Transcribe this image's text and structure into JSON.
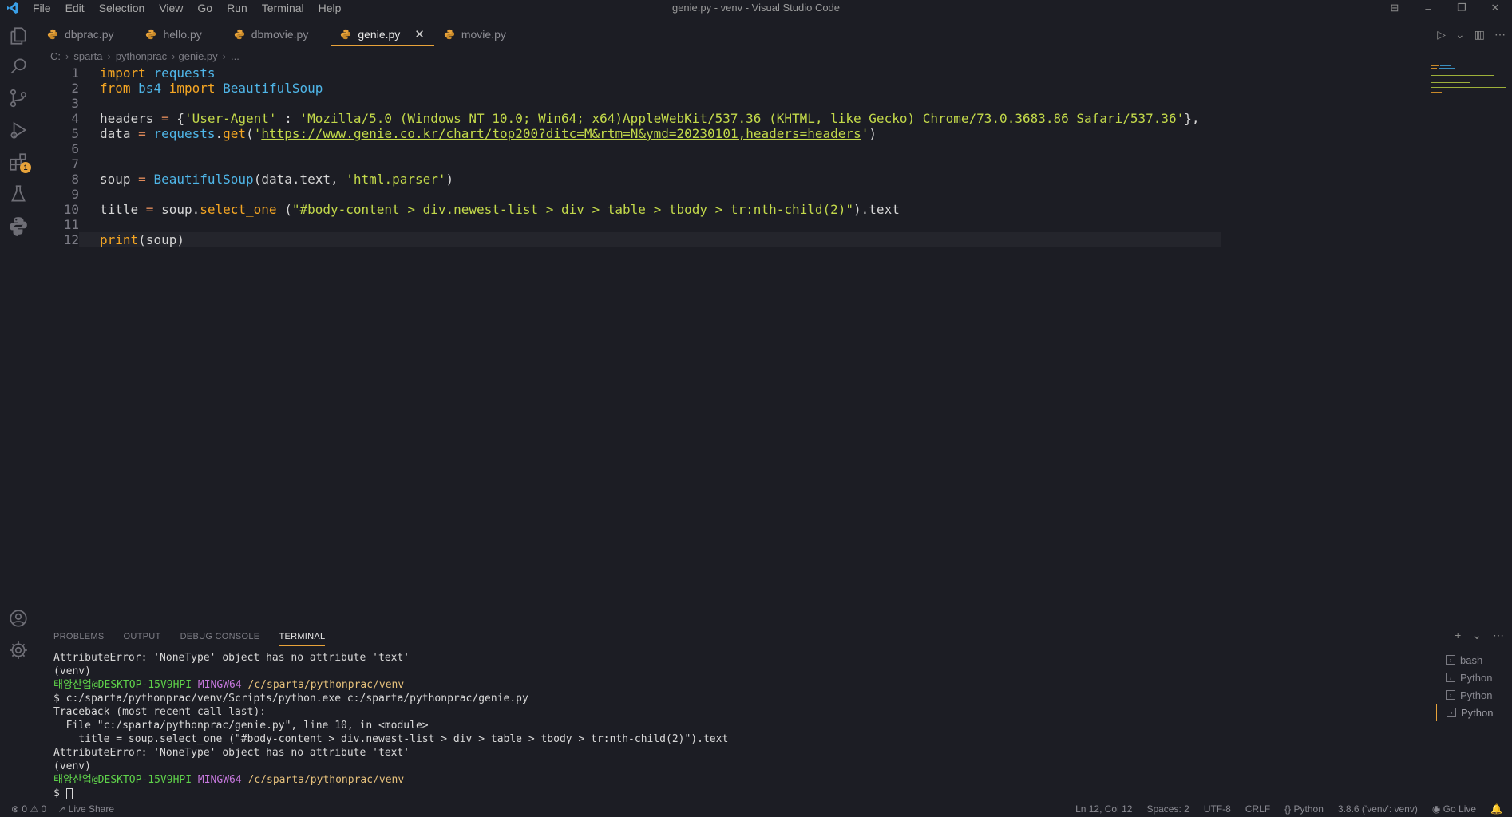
{
  "window": {
    "title": "genie.py - venv - Visual Studio Code",
    "controls": [
      "⊟",
      "–",
      "❐",
      "✕"
    ]
  },
  "menu": [
    "File",
    "Edit",
    "Selection",
    "View",
    "Go",
    "Run",
    "Terminal",
    "Help"
  ],
  "tabs": [
    {
      "label": "dbprac.py",
      "active": false
    },
    {
      "label": "hello.py",
      "active": false
    },
    {
      "label": "dbmovie.py",
      "active": false
    },
    {
      "label": "genie.py",
      "active": true
    },
    {
      "label": "movie.py",
      "active": false
    }
  ],
  "breadcrumb": [
    "C:",
    "sparta",
    "pythonprac",
    "genie.py",
    "..."
  ],
  "editor": {
    "lines": [
      {
        "num": "1",
        "tokens": [
          [
            "kw",
            "import"
          ],
          [
            "plain",
            " "
          ],
          [
            "mod",
            "requests"
          ]
        ]
      },
      {
        "num": "2",
        "tokens": [
          [
            "kw",
            "from"
          ],
          [
            "plain",
            " "
          ],
          [
            "mod",
            "bs4"
          ],
          [
            "plain",
            " "
          ],
          [
            "kw",
            "import"
          ],
          [
            "plain",
            " "
          ],
          [
            "cls",
            "BeautifulSoup"
          ]
        ]
      },
      {
        "num": "3",
        "tokens": []
      },
      {
        "num": "4",
        "tokens": [
          [
            "plain",
            "headers "
          ],
          [
            "op",
            "="
          ],
          [
            "plain",
            " {"
          ],
          [
            "str",
            "'User-Agent'"
          ],
          [
            "plain",
            " : "
          ],
          [
            "str",
            "'Mozilla/5.0 (Windows NT 10.0; Win64; x64)AppleWebKit/537.36 (KHTML, like Gecko) Chrome/73.0.3683.86 Safari/537.36'"
          ],
          [
            "plain",
            "},"
          ]
        ]
      },
      {
        "num": "5",
        "tokens": [
          [
            "plain",
            "data "
          ],
          [
            "op",
            "="
          ],
          [
            "plain",
            " "
          ],
          [
            "mod",
            "requests"
          ],
          [
            "plain",
            "."
          ],
          [
            "fn",
            "get"
          ],
          [
            "plain",
            "("
          ],
          [
            "str",
            "'"
          ],
          [
            "url",
            "https://www.genie.co.kr/chart/top200?ditc=M&rtm=N&ymd=20230101,headers=headers"
          ],
          [
            "str",
            "'"
          ],
          [
            "plain",
            ")"
          ]
        ]
      },
      {
        "num": "6",
        "tokens": []
      },
      {
        "num": "7",
        "tokens": []
      },
      {
        "num": "8",
        "tokens": [
          [
            "plain",
            "soup "
          ],
          [
            "op",
            "="
          ],
          [
            "plain",
            " "
          ],
          [
            "cls",
            "BeautifulSoup"
          ],
          [
            "plain",
            "(data.text, "
          ],
          [
            "str",
            "'html.parser'"
          ],
          [
            "plain",
            ")"
          ]
        ]
      },
      {
        "num": "9",
        "tokens": []
      },
      {
        "num": "10",
        "tokens": [
          [
            "plain",
            "title "
          ],
          [
            "op",
            "="
          ],
          [
            "plain",
            " soup."
          ],
          [
            "fn",
            "select_one"
          ],
          [
            "plain",
            " ("
          ],
          [
            "str",
            "\"#body-content > div.newest-list > div > table > tbody > tr:nth-child(2)\""
          ],
          [
            "plain",
            ").text"
          ]
        ]
      },
      {
        "num": "11",
        "tokens": []
      },
      {
        "num": "12",
        "tokens": [
          [
            "fn",
            "print"
          ],
          [
            "plain",
            "(soup)"
          ]
        ]
      }
    ]
  },
  "panel": {
    "tabs": [
      "PROBLEMS",
      "OUTPUT",
      "DEBUG CONSOLE",
      "TERMINAL"
    ],
    "active_tab": "TERMINAL",
    "actions": [
      "+",
      "⌄",
      "⋯"
    ],
    "terminal_lines": [
      [
        [
          "",
          "AttributeError: 'NoneType' object has no attribute 'text'"
        ]
      ],
      [
        [
          "",
          "(venv)"
        ]
      ],
      [
        [
          "t-green",
          "태양산업@DESKTOP-15V9HPI "
        ],
        [
          "t-purple",
          "MINGW64 "
        ],
        [
          "t-yellow",
          "/c/sparta/pythonprac/venv"
        ]
      ],
      [
        [
          "",
          "$ c:/sparta/pythonprac/venv/Scripts/python.exe c:/sparta/pythonprac/genie.py"
        ]
      ],
      [
        [
          "",
          "Traceback (most recent call last):"
        ]
      ],
      [
        [
          "",
          "  File \"c:/sparta/pythonprac/genie.py\", line 10, in <module>"
        ]
      ],
      [
        [
          "",
          "    title = soup.select_one (\"#body-content > div.newest-list > div > table > tbody > tr:nth-child(2)\").text"
        ]
      ],
      [
        [
          "",
          "AttributeError: 'NoneType' object has no attribute 'text'"
        ]
      ],
      [
        [
          "",
          "(venv)"
        ]
      ],
      [
        [
          "t-green",
          "태양산업@DESKTOP-15V9HPI "
        ],
        [
          "t-purple",
          "MINGW64 "
        ],
        [
          "t-yellow",
          "/c/sparta/pythonprac/venv"
        ]
      ],
      [
        [
          "",
          "$ "
        ]
      ]
    ],
    "terminal_list": [
      {
        "label": "bash",
        "active": false
      },
      {
        "label": "Python",
        "active": false
      },
      {
        "label": "Python",
        "active": false
      },
      {
        "label": "Python",
        "active": true
      }
    ]
  },
  "statusbar": {
    "errors": "0",
    "warnings": "0",
    "live_share": "Live Share",
    "position": "Ln 12, Col 12",
    "spaces": "Spaces: 2",
    "encoding": "UTF-8",
    "eol": "CRLF",
    "language": "Python",
    "interpreter": "3.8.6 ('venv': venv)",
    "go_live": "Go Live"
  },
  "colors": {
    "accent": "#e8a33a",
    "keyword": "#f5a623",
    "module": "#4fb6e8",
    "string": "#c3d94a",
    "background": "#1c1d24"
  }
}
